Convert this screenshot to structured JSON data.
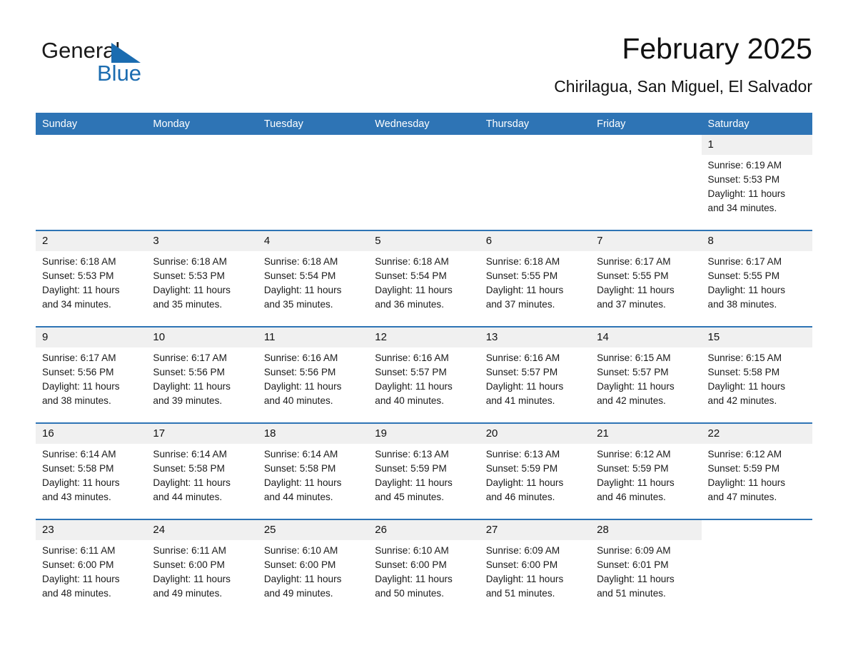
{
  "brand": {
    "name_part1": "General",
    "name_part2": "Blue",
    "accent_color": "#1b6cb0"
  },
  "header": {
    "month_title": "February 2025",
    "location": "Chirilagua, San Miguel, El Salvador"
  },
  "calendar": {
    "header_color": "#2e74b5",
    "daystrip_color": "#f0f0f0",
    "weekdays": [
      "Sunday",
      "Monday",
      "Tuesday",
      "Wednesday",
      "Thursday",
      "Friday",
      "Saturday"
    ],
    "weeks": [
      [
        {
          "day": "",
          "blank": true
        },
        {
          "day": "",
          "blank": true
        },
        {
          "day": "",
          "blank": true
        },
        {
          "day": "",
          "blank": true
        },
        {
          "day": "",
          "blank": true
        },
        {
          "day": "",
          "blank": true
        },
        {
          "day": "1",
          "sunrise": "Sunrise: 6:19 AM",
          "sunset": "Sunset: 5:53 PM",
          "daylight1": "Daylight: 11 hours",
          "daylight2": "and 34 minutes."
        }
      ],
      [
        {
          "day": "2",
          "sunrise": "Sunrise: 6:18 AM",
          "sunset": "Sunset: 5:53 PM",
          "daylight1": "Daylight: 11 hours",
          "daylight2": "and 34 minutes."
        },
        {
          "day": "3",
          "sunrise": "Sunrise: 6:18 AM",
          "sunset": "Sunset: 5:53 PM",
          "daylight1": "Daylight: 11 hours",
          "daylight2": "and 35 minutes."
        },
        {
          "day": "4",
          "sunrise": "Sunrise: 6:18 AM",
          "sunset": "Sunset: 5:54 PM",
          "daylight1": "Daylight: 11 hours",
          "daylight2": "and 35 minutes."
        },
        {
          "day": "5",
          "sunrise": "Sunrise: 6:18 AM",
          "sunset": "Sunset: 5:54 PM",
          "daylight1": "Daylight: 11 hours",
          "daylight2": "and 36 minutes."
        },
        {
          "day": "6",
          "sunrise": "Sunrise: 6:18 AM",
          "sunset": "Sunset: 5:55 PM",
          "daylight1": "Daylight: 11 hours",
          "daylight2": "and 37 minutes."
        },
        {
          "day": "7",
          "sunrise": "Sunrise: 6:17 AM",
          "sunset": "Sunset: 5:55 PM",
          "daylight1": "Daylight: 11 hours",
          "daylight2": "and 37 minutes."
        },
        {
          "day": "8",
          "sunrise": "Sunrise: 6:17 AM",
          "sunset": "Sunset: 5:55 PM",
          "daylight1": "Daylight: 11 hours",
          "daylight2": "and 38 minutes."
        }
      ],
      [
        {
          "day": "9",
          "sunrise": "Sunrise: 6:17 AM",
          "sunset": "Sunset: 5:56 PM",
          "daylight1": "Daylight: 11 hours",
          "daylight2": "and 38 minutes."
        },
        {
          "day": "10",
          "sunrise": "Sunrise: 6:17 AM",
          "sunset": "Sunset: 5:56 PM",
          "daylight1": "Daylight: 11 hours",
          "daylight2": "and 39 minutes."
        },
        {
          "day": "11",
          "sunrise": "Sunrise: 6:16 AM",
          "sunset": "Sunset: 5:56 PM",
          "daylight1": "Daylight: 11 hours",
          "daylight2": "and 40 minutes."
        },
        {
          "day": "12",
          "sunrise": "Sunrise: 6:16 AM",
          "sunset": "Sunset: 5:57 PM",
          "daylight1": "Daylight: 11 hours",
          "daylight2": "and 40 minutes."
        },
        {
          "day": "13",
          "sunrise": "Sunrise: 6:16 AM",
          "sunset": "Sunset: 5:57 PM",
          "daylight1": "Daylight: 11 hours",
          "daylight2": "and 41 minutes."
        },
        {
          "day": "14",
          "sunrise": "Sunrise: 6:15 AM",
          "sunset": "Sunset: 5:57 PM",
          "daylight1": "Daylight: 11 hours",
          "daylight2": "and 42 minutes."
        },
        {
          "day": "15",
          "sunrise": "Sunrise: 6:15 AM",
          "sunset": "Sunset: 5:58 PM",
          "daylight1": "Daylight: 11 hours",
          "daylight2": "and 42 minutes."
        }
      ],
      [
        {
          "day": "16",
          "sunrise": "Sunrise: 6:14 AM",
          "sunset": "Sunset: 5:58 PM",
          "daylight1": "Daylight: 11 hours",
          "daylight2": "and 43 minutes."
        },
        {
          "day": "17",
          "sunrise": "Sunrise: 6:14 AM",
          "sunset": "Sunset: 5:58 PM",
          "daylight1": "Daylight: 11 hours",
          "daylight2": "and 44 minutes."
        },
        {
          "day": "18",
          "sunrise": "Sunrise: 6:14 AM",
          "sunset": "Sunset: 5:58 PM",
          "daylight1": "Daylight: 11 hours",
          "daylight2": "and 44 minutes."
        },
        {
          "day": "19",
          "sunrise": "Sunrise: 6:13 AM",
          "sunset": "Sunset: 5:59 PM",
          "daylight1": "Daylight: 11 hours",
          "daylight2": "and 45 minutes."
        },
        {
          "day": "20",
          "sunrise": "Sunrise: 6:13 AM",
          "sunset": "Sunset: 5:59 PM",
          "daylight1": "Daylight: 11 hours",
          "daylight2": "and 46 minutes."
        },
        {
          "day": "21",
          "sunrise": "Sunrise: 6:12 AM",
          "sunset": "Sunset: 5:59 PM",
          "daylight1": "Daylight: 11 hours",
          "daylight2": "and 46 minutes."
        },
        {
          "day": "22",
          "sunrise": "Sunrise: 6:12 AM",
          "sunset": "Sunset: 5:59 PM",
          "daylight1": "Daylight: 11 hours",
          "daylight2": "and 47 minutes."
        }
      ],
      [
        {
          "day": "23",
          "sunrise": "Sunrise: 6:11 AM",
          "sunset": "Sunset: 6:00 PM",
          "daylight1": "Daylight: 11 hours",
          "daylight2": "and 48 minutes."
        },
        {
          "day": "24",
          "sunrise": "Sunrise: 6:11 AM",
          "sunset": "Sunset: 6:00 PM",
          "daylight1": "Daylight: 11 hours",
          "daylight2": "and 49 minutes."
        },
        {
          "day": "25",
          "sunrise": "Sunrise: 6:10 AM",
          "sunset": "Sunset: 6:00 PM",
          "daylight1": "Daylight: 11 hours",
          "daylight2": "and 49 minutes."
        },
        {
          "day": "26",
          "sunrise": "Sunrise: 6:10 AM",
          "sunset": "Sunset: 6:00 PM",
          "daylight1": "Daylight: 11 hours",
          "daylight2": "and 50 minutes."
        },
        {
          "day": "27",
          "sunrise": "Sunrise: 6:09 AM",
          "sunset": "Sunset: 6:00 PM",
          "daylight1": "Daylight: 11 hours",
          "daylight2": "and 51 minutes."
        },
        {
          "day": "28",
          "sunrise": "Sunrise: 6:09 AM",
          "sunset": "Sunset: 6:01 PM",
          "daylight1": "Daylight: 11 hours",
          "daylight2": "and 51 minutes."
        },
        {
          "day": "",
          "blank": true
        }
      ]
    ]
  }
}
